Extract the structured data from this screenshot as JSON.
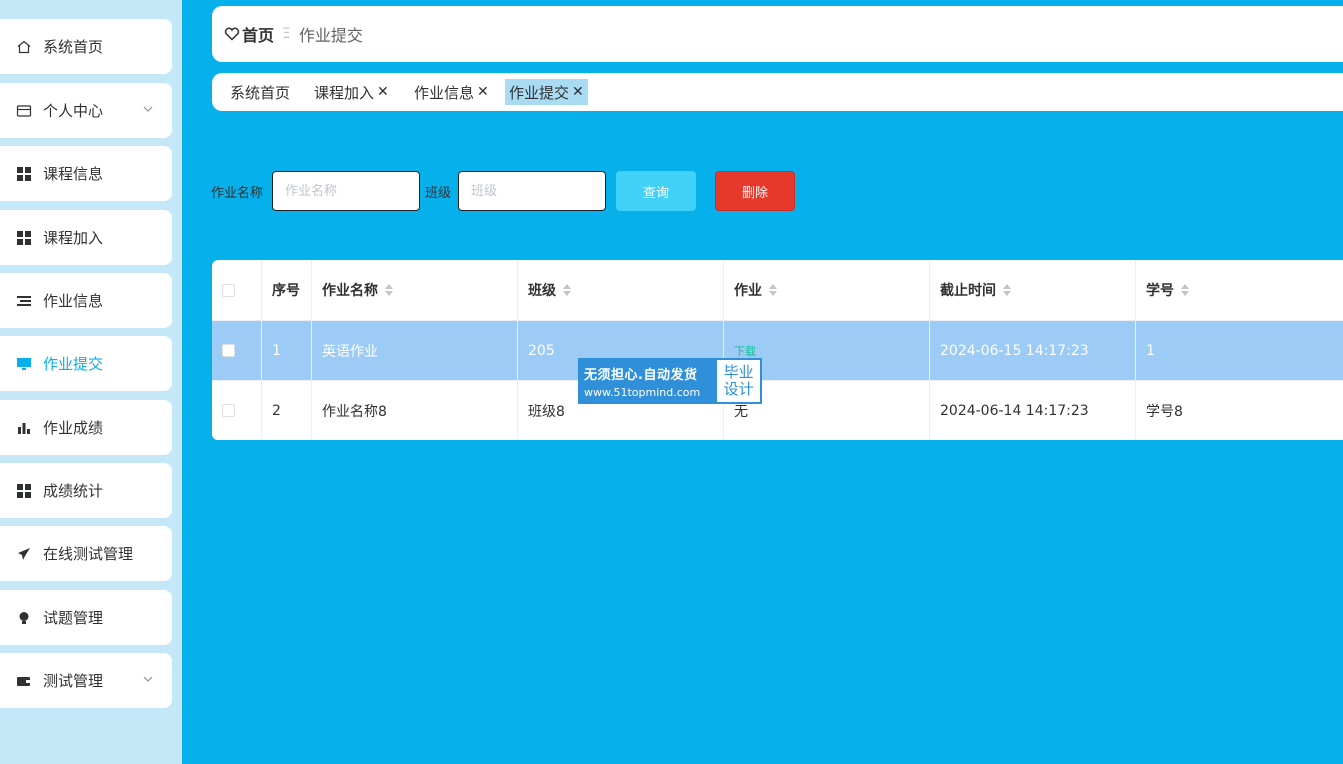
{
  "sidebar": {
    "items": [
      {
        "label": "系统首页",
        "icon": "home-icon",
        "active": false,
        "has_chevron": false
      },
      {
        "label": "个人中心",
        "icon": "wallet-icon",
        "active": false,
        "has_chevron": true
      },
      {
        "label": "课程信息",
        "icon": "grid-icon",
        "active": false,
        "has_chevron": false
      },
      {
        "label": "课程加入",
        "icon": "grid-icon",
        "active": false,
        "has_chevron": false
      },
      {
        "label": "作业信息",
        "icon": "list-icon",
        "active": false,
        "has_chevron": false
      },
      {
        "label": "作业提交",
        "icon": "monitor-icon",
        "active": true,
        "has_chevron": false
      },
      {
        "label": "作业成绩",
        "icon": "bar-chart-icon",
        "active": false,
        "has_chevron": false
      },
      {
        "label": "成绩统计",
        "icon": "grid-icon",
        "active": false,
        "has_chevron": false
      },
      {
        "label": "在线测试管理",
        "icon": "send-icon",
        "active": false,
        "has_chevron": false
      },
      {
        "label": "试题管理",
        "icon": "bulb-icon",
        "active": false,
        "has_chevron": false
      },
      {
        "label": "测试管理",
        "icon": "wallet-filled-icon",
        "active": false,
        "has_chevron": true
      }
    ]
  },
  "header": {
    "home": "首页",
    "separator": "Ξ",
    "current": "作业提交"
  },
  "tags": [
    {
      "label": "系统首页",
      "closable": false,
      "active": false
    },
    {
      "label": "课程加入",
      "closable": true,
      "active": false
    },
    {
      "label": "作业信息",
      "closable": true,
      "active": false
    },
    {
      "label": "作业提交",
      "closable": true,
      "active": true
    }
  ],
  "search": {
    "name_label": "作业名称",
    "name_placeholder": "作业名称",
    "class_label": "班级",
    "class_placeholder": "班级",
    "query_button": "查询",
    "delete_button": "删除"
  },
  "table": {
    "columns": [
      "序号",
      "作业名称",
      "班级",
      "作业",
      "截止时间",
      "学号"
    ],
    "rows": [
      {
        "index": "1",
        "name": "英语作业",
        "class": "205",
        "homework": "下载",
        "deadline": "2024-06-15 14:17:23",
        "student_no": "1",
        "selected": true
      },
      {
        "index": "2",
        "name": "作业名称8",
        "class": "班级8",
        "homework": "无",
        "deadline": "2024-06-14 14:17:23",
        "student_no": "学号8",
        "selected": false
      }
    ]
  },
  "watermark": {
    "line1": "无须担心.自动发货",
    "line2": "www.51topmind.com",
    "badge_line1": "毕业",
    "badge_line2": "设计"
  },
  "colors": {
    "background": "#06b0ea",
    "sidebar_bg": "#c5e8f8",
    "active_text": "#06b0ea",
    "query_button": "#41d0f6",
    "delete_button": "#e6392c",
    "selected_row": "#9ccbf5",
    "active_tag": "#a9dcf2"
  }
}
